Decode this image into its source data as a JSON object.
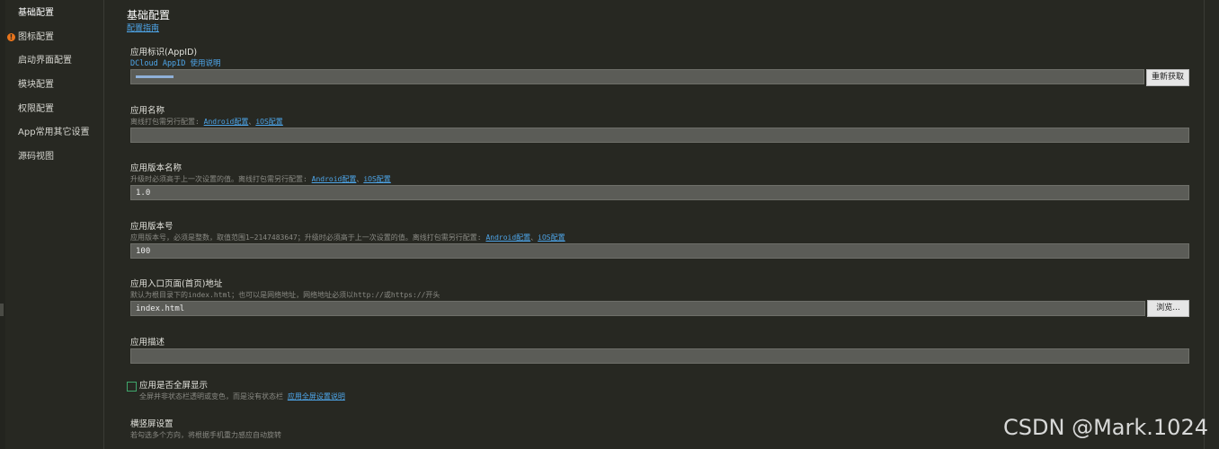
{
  "sidebar": {
    "items": [
      {
        "label": "基础配置"
      },
      {
        "label": "图标配置",
        "warning": "!"
      },
      {
        "label": "启动界面配置"
      },
      {
        "label": "模块配置"
      },
      {
        "label": "权限配置"
      },
      {
        "label": "App常用其它设置"
      },
      {
        "label": "源码视图"
      }
    ]
  },
  "header": {
    "title": "基础配置",
    "guide_link": "配置指南"
  },
  "appid": {
    "label": "应用标识(AppID)",
    "link": "DCloud AppID 使用说明",
    "value": "",
    "refresh_button": "重新获取"
  },
  "app_name": {
    "label": "应用名称",
    "desc_prefix": "离线打包需另行配置: ",
    "android_link": "Android配置",
    "separator": "、",
    "ios_link": "iOS配置",
    "value": ""
  },
  "version_name": {
    "label": "应用版本名称",
    "desc_prefix": "升级时必须高于上一次设置的值。离线打包需另行配置: ",
    "android_link": "Android配置",
    "separator": "、",
    "ios_link": "iOS配置",
    "value": "1.0"
  },
  "version_code": {
    "label": "应用版本号",
    "desc_prefix": "应用版本号，必须是整数，取值范围1~2147483647；升级时必须高于上一次设置的值。离线打包需另行配置: ",
    "android_link": "Android配置",
    "separator": "、",
    "ios_link": "iOS配置",
    "value": "100"
  },
  "entry_page": {
    "label": "应用入口页面(首页)地址",
    "desc": "默认为根目录下的index.html；也可以是网络地址，网络地址必须以http://或https://开头",
    "value": "index.html",
    "browse_button": "浏览..."
  },
  "description": {
    "label": "应用描述",
    "value": ""
  },
  "fullscreen": {
    "label": "应用是否全屏显示",
    "checked": false,
    "desc": "全屏并非状态栏透明或变色，而是没有状态栏 ",
    "link": "应用全屏设置说明"
  },
  "orientation": {
    "label": "横竖屏设置",
    "desc": "若勾选多个方向，将根据手机重力感应自动旋转"
  },
  "watermark": "CSDN @Mark.1024",
  "colors": {
    "background": "#272822",
    "link": "#4ea6ea",
    "warning": "#e8741c",
    "checkbox_border": "#3fa66b"
  }
}
